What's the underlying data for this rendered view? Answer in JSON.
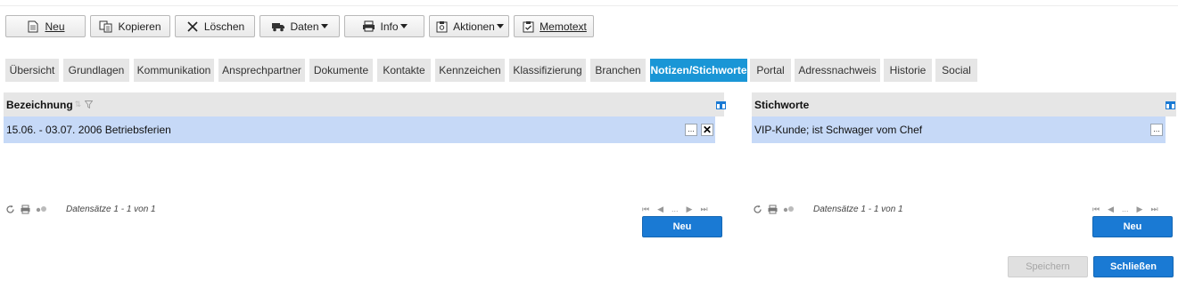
{
  "toolbar": {
    "neu": "Neu",
    "kopieren": "Kopieren",
    "loeschen": "Löschen",
    "daten": "Daten",
    "info": "Info",
    "aktionen": "Aktionen",
    "memotext": "Memotext"
  },
  "tabs": [
    {
      "label": "Übersicht"
    },
    {
      "label": "Grundlagen"
    },
    {
      "label": "Kommunikation"
    },
    {
      "label": "Ansprechpartner"
    },
    {
      "label": "Dokumente"
    },
    {
      "label": "Kontakte"
    },
    {
      "label": "Kennzeichen"
    },
    {
      "label": "Klassifizierung"
    },
    {
      "label": "Branchen"
    },
    {
      "label": "Notizen/Stichworte",
      "active": true
    },
    {
      "label": "Portal"
    },
    {
      "label": "Adressnachweis"
    },
    {
      "label": "Historie"
    },
    {
      "label": "Social"
    }
  ],
  "left_grid": {
    "header": "Bezeichnung",
    "rows": [
      {
        "text": "15.06. - 03.07. 2006 Betriebsferien"
      }
    ],
    "row_btn_more": "...",
    "row_btn_delete": "✕",
    "count": "Datensätze 1 - 1 von 1",
    "pager_ellipsis": "...",
    "new_button": "Neu"
  },
  "right_grid": {
    "header": "Stichworte",
    "rows": [
      {
        "text": "VIP-Kunde; ist Schwager vom Chef"
      }
    ],
    "row_btn_more": "...",
    "count": "Datensätze 1 - 1 von 1",
    "pager_ellipsis": "...",
    "new_button": "Neu"
  },
  "footer": {
    "save": "Speichern",
    "close": "Schließen"
  },
  "colors": {
    "accent": "#1a96d6",
    "button_blue": "#1a7ad4",
    "row_selected": "#c6d9f7"
  }
}
